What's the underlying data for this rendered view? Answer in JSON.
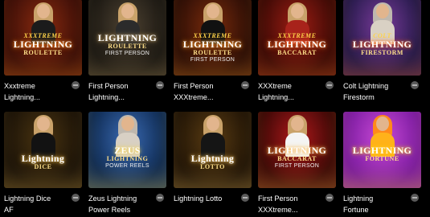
{
  "games": [
    {
      "title_line1": "Xxxtreme",
      "title_line2": "Lightning...",
      "logo": [
        "XXXTREME",
        "LIGHTNING",
        "ROULETTE",
        ""
      ],
      "colors": {
        "bg": "#3a0e08",
        "bg2": "#8a2a0e",
        "accent": "#ff8a1e",
        "figure": "#1b1b1b"
      }
    },
    {
      "title_line1": "First Person",
      "title_line2": "Lightning...",
      "logo": [
        "",
        "LIGHTNING",
        "ROULETTE",
        "FIRST PERSON"
      ],
      "colors": {
        "bg": "#1a1712",
        "bg2": "#4e4231",
        "accent": "#c7a56a",
        "figure": "#2b2b2b"
      }
    },
    {
      "title_line1": "First Person",
      "title_line2": "XXXtreme...",
      "logo": [
        "XXXTREME",
        "LIGHTNING",
        "ROULETTE",
        "FIRST PERSON"
      ],
      "colors": {
        "bg": "#2a0d06",
        "bg2": "#7a2b0b",
        "accent": "#ff9c2a",
        "figure": "#111"
      }
    },
    {
      "title_line1": "XXXtreme",
      "title_line2": "Lightning...",
      "logo": [
        "XXXTREME",
        "LIGHTNING",
        "BACCARAT",
        ""
      ],
      "colors": {
        "bg": "#3a0a06",
        "bg2": "#9e1c12",
        "accent": "#ff7a2a",
        "figure": "#a8231b"
      }
    },
    {
      "title_line1": "Colt Lightning",
      "title_line2": "Firestorm",
      "logo": [
        "COLT",
        "LIGHTNING",
        "FIRESTORM",
        ""
      ],
      "colors": {
        "bg": "#241a4a",
        "bg2": "#7a3a9a",
        "accent": "#ff6a1a",
        "figure": "#d9d1c4"
      }
    },
    {
      "title_line1": "Lightning Dice",
      "title_line2": "AF",
      "logo": [
        "",
        "Lightning",
        "DICE",
        ""
      ],
      "colors": {
        "bg": "#1a1208",
        "bg2": "#4a3410",
        "accent": "#e2b24a",
        "figure": "#121212"
      }
    },
    {
      "title_line1": "Zeus Lightning",
      "title_line2": "Power Reels",
      "logo": [
        "",
        "ZEUS",
        "LIGHTNING",
        "POWER REELS"
      ],
      "colors": {
        "bg": "#0e2a52",
        "bg2": "#3a6ab2",
        "accent": "#ffd84a",
        "figure": "#d8d0c4"
      }
    },
    {
      "title_line1": "Lightning Lotto",
      "title_line2": "",
      "logo": [
        "",
        "Lightning",
        "LOTTO",
        ""
      ],
      "colors": {
        "bg": "#1f1306",
        "bg2": "#5a3c12",
        "accent": "#f0c060",
        "figure": "#151515"
      }
    },
    {
      "title_line1": "First Person",
      "title_line2": "XXXtreme...",
      "logo": [
        "",
        "LIGHTNING",
        "BACCARAT",
        "FIRST PERSON"
      ],
      "colors": {
        "bg": "#3a0806",
        "bg2": "#b0181a",
        "accent": "#ffb84a",
        "figure": "#f4f4f4"
      }
    },
    {
      "title_line1": "Lightning",
      "title_line2": "Fortune",
      "logo": [
        "",
        "LIGHTNING",
        "FORTUNE",
        ""
      ],
      "colors": {
        "bg": "#7a1aa0",
        "bg2": "#c94ad6",
        "accent": "#ffd21a",
        "figure": "#ffb21a"
      }
    }
  ]
}
